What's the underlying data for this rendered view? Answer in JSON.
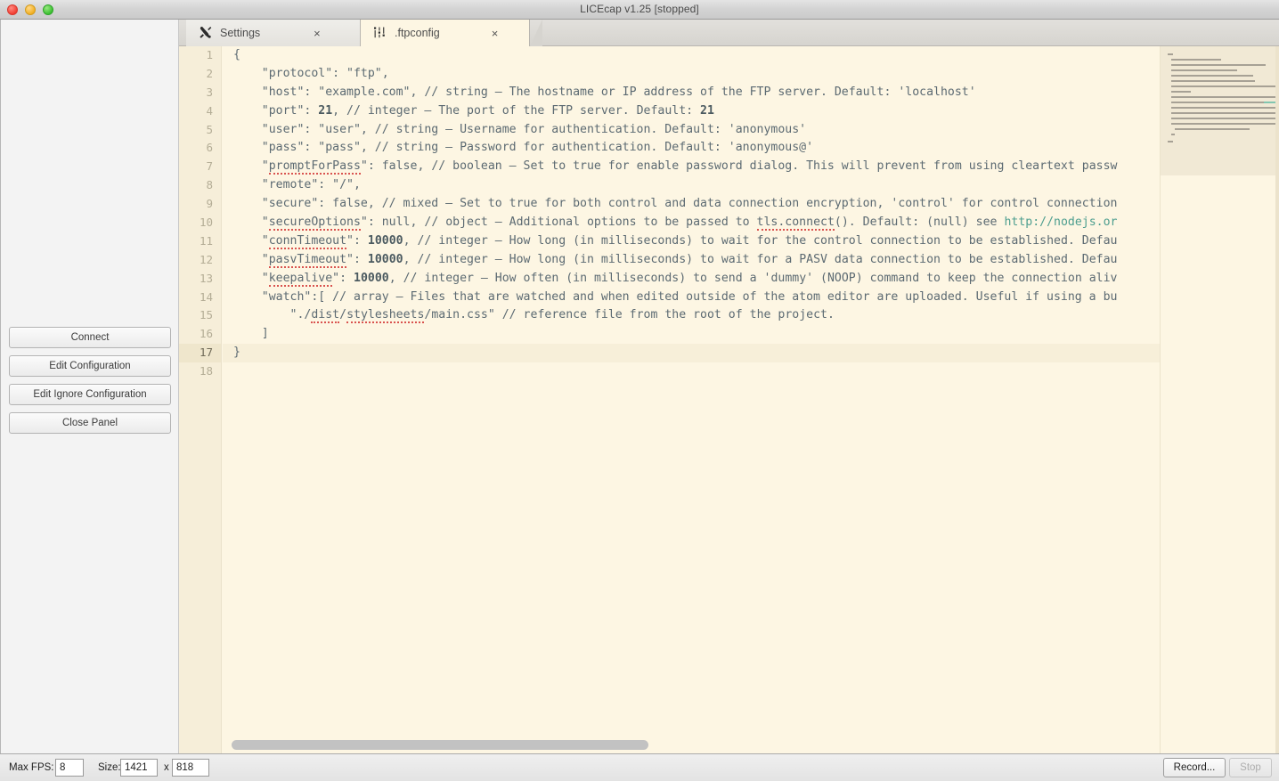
{
  "window": {
    "title": "LICEcap v1.25 [stopped]",
    "traffic_lights": [
      "close-button",
      "minimize-button",
      "maximize-button"
    ]
  },
  "sidebar": {
    "buttons": [
      {
        "label": "Connect",
        "name": "connect-button"
      },
      {
        "label": "Edit Configuration",
        "name": "edit-configuration-button"
      },
      {
        "label": "Edit Ignore Configuration",
        "name": "edit-ignore-configuration-button"
      },
      {
        "label": "Close Panel",
        "name": "close-panel-button"
      }
    ]
  },
  "tabs": [
    {
      "label": "Settings",
      "icon": "tools-icon",
      "close": "×",
      "active": false
    },
    {
      "label": ".ftpconfig",
      "icon": "config-icon",
      "close": "×",
      "active": true
    }
  ],
  "editor": {
    "cursor_line": 17,
    "total_lines": 18,
    "line_numbers": [
      "1",
      "2",
      "3",
      "4",
      "5",
      "6",
      "7",
      "8",
      "9",
      "10",
      "11",
      "12",
      "13",
      "14",
      "15",
      "16",
      "17",
      "18"
    ],
    "lines": [
      "{",
      "    \"protocol\": \"ftp\",",
      "    \"host\": \"example.com\", // string — The hostname or IP address of the FTP server. Default: 'localhost'",
      "    \"port\": 21, // integer — The port of the FTP server. Default: 21",
      "    \"user\": \"user\", // string — Username for authentication. Default: 'anonymous'",
      "    \"pass\": \"pass\", // string — Password for authentication. Default: 'anonymous@'",
      "    \"promptForPass\": false, // boolean — Set to true for enable password dialog. This will prevent from using cleartext passw",
      "    \"remote\": \"/\",",
      "    \"secure\": false, // mixed — Set to true for both control and data connection encryption, 'control' for control connection",
      "    \"secureOptions\": null, // object — Additional options to be passed to tls.connect(). Default: (null) see http://nodejs.or",
      "    \"connTimeout\": 10000, // integer — How long (in milliseconds) to wait for the control connection to be established. Defau",
      "    \"pasvTimeout\": 10000, // integer — How long (in milliseconds) to wait for a PASV data connection to be established. Defau",
      "    \"keepalive\": 10000, // integer — How often (in milliseconds) to send a 'dummy' (NOOP) command to keep the connection aliv",
      "    \"watch\":[ // array — Files that are watched and when edited outside of the atom editor are uploaded. Useful if using a bu",
      "        \"./dist/stylesheets/main.css\" // reference file from the root of the project.",
      "    ]",
      "}",
      ""
    ],
    "colors": {
      "background": "#fdf6e3",
      "text": "#5c6a72",
      "gutter_background": "#f6eed9",
      "gutter_text": "#b4ad96",
      "cursor_line_background": "#f7efd9",
      "link": "#4d9e8f",
      "spellcheck_underline": "#d9534f"
    }
  },
  "statusbar": {
    "max_fps_label": "Max FPS:",
    "max_fps_value": "8",
    "size_label": "Size:",
    "size_width": "1421",
    "size_separator": "x",
    "size_height": "818",
    "record_label": "Record...",
    "stop_label": "Stop",
    "stop_disabled": true
  }
}
